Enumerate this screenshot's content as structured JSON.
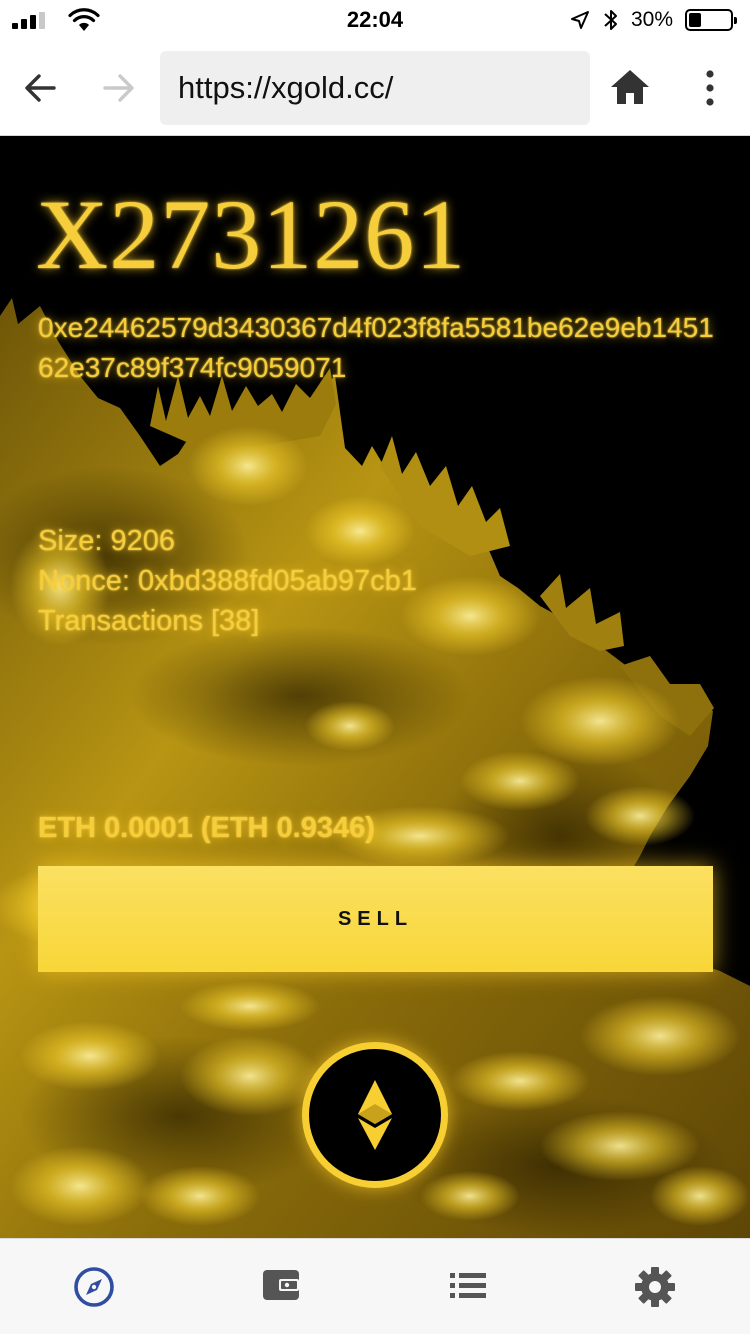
{
  "status_bar": {
    "time": "22:04",
    "battery_percent": "30%",
    "battery_level": 0.3,
    "signal_bars_active": 3,
    "signal_bars_total": 4
  },
  "browser": {
    "url": "https://xgold.cc/"
  },
  "block": {
    "title": "X2731261",
    "hash": "0xe24462579d3430367d4f023f8fa5581be62e9eb145162e37c89f374fc9059071",
    "size_text": "Size: 9206",
    "nonce_text": "Nonce: 0xbd388fd05ab97cb1",
    "transactions_text": "Transactions [38]"
  },
  "price": {
    "text": "ETH 0.0001 (ETH 0.9346)"
  },
  "actions": {
    "sell_label": "SELL"
  },
  "tab_bar": {
    "tabs": [
      {
        "icon": "compass-icon",
        "active": true
      },
      {
        "icon": "wallet-icon",
        "active": false
      },
      {
        "icon": "list-icon",
        "active": false
      },
      {
        "icon": "gear-icon",
        "active": false
      }
    ]
  },
  "colors": {
    "gold_text": "#f6cd3a",
    "sell_button": "#f9d93f",
    "active_tab": "#2f4ea0",
    "inactive_tab": "#555555",
    "background": "#000000"
  }
}
